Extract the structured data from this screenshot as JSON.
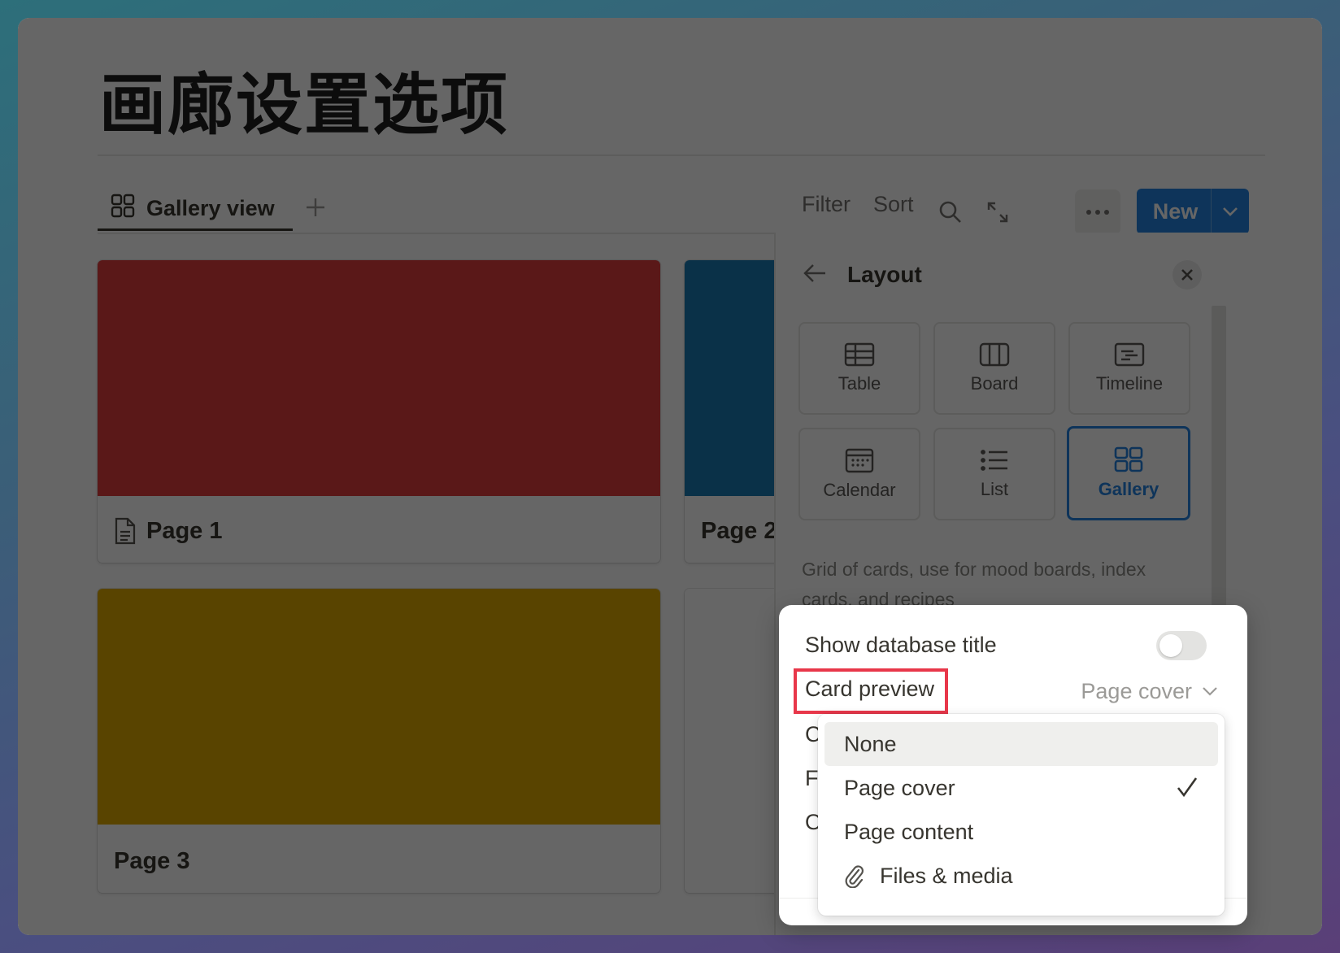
{
  "page": {
    "title": "画廊设置选项"
  },
  "view_tab": {
    "label": "Gallery view",
    "icon": "gallery-grid-icon"
  },
  "toolbar": {
    "filter_label": "Filter",
    "sort_label": "Sort",
    "new_label": "New",
    "accent_color": "#2383e2"
  },
  "cards": [
    {
      "label": "Page 1",
      "cover_color": "#e03e3e",
      "icon": "page-icon"
    },
    {
      "label": "Page 2",
      "cover_color": "#1a7ab3"
    },
    {
      "label": "Page 3",
      "cover_color": "#dfab01"
    }
  ],
  "panel": {
    "title": "Layout",
    "options": [
      {
        "label": "Table",
        "icon": "table-icon",
        "selected": false
      },
      {
        "label": "Board",
        "icon": "board-icon",
        "selected": false
      },
      {
        "label": "Timeline",
        "icon": "timeline-icon",
        "selected": false
      },
      {
        "label": "Calendar",
        "icon": "calendar-icon",
        "selected": false
      },
      {
        "label": "List",
        "icon": "list-icon",
        "selected": false
      },
      {
        "label": "Gallery",
        "icon": "gallery-icon",
        "selected": true
      }
    ],
    "description": "Grid of cards, use for mood boards, index cards, and recipes"
  },
  "settings": {
    "show_title_label": "Show database title",
    "show_title_enabled": false,
    "card_preview_label": "Card preview",
    "card_preview_value": "Page cover",
    "hidden_rows_initials": [
      "C",
      "Fi",
      "O"
    ],
    "highlight_color": "#e8374a"
  },
  "dropdown": {
    "options": [
      {
        "label": "None",
        "hovered": true,
        "checked": false
      },
      {
        "label": "Page cover",
        "hovered": false,
        "checked": true
      },
      {
        "label": "Page content",
        "hovered": false,
        "checked": false
      },
      {
        "label": "Files & media",
        "hovered": false,
        "checked": false,
        "icon": "paperclip-icon"
      }
    ]
  }
}
